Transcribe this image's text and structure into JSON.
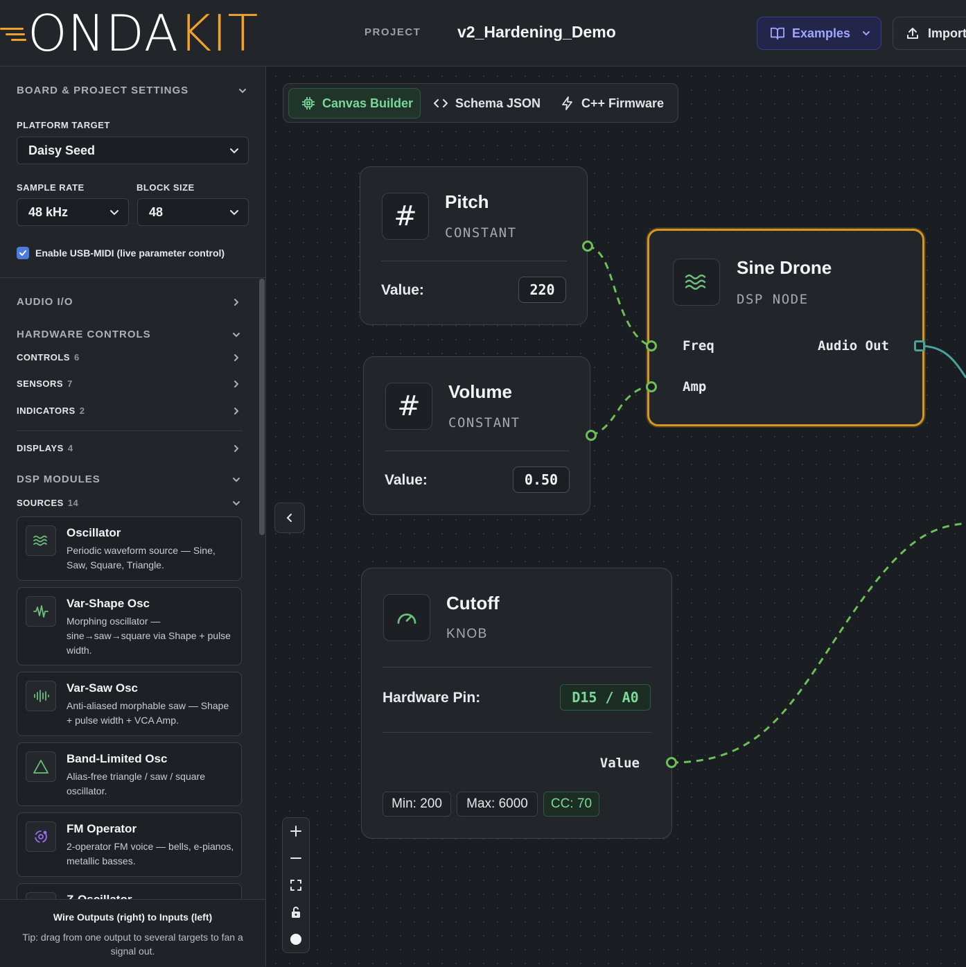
{
  "header": {
    "logo_left": "ONDA",
    "logo_right": "KIT",
    "project_label": "PROJECT",
    "project_name": "v2_Hardening_Demo",
    "examples_label": "Examples",
    "import_label": "Import"
  },
  "sidebar": {
    "board_title": "BOARD & PROJECT SETTINGS",
    "platform_label": "PLATFORM TARGET",
    "platform_value": "Daisy Seed",
    "sample_rate_label": "SAMPLE RATE",
    "sample_rate_value": "48 kHz",
    "block_size_label": "BLOCK SIZE",
    "block_size_value": "48",
    "usb_midi_label": "Enable USB-MIDI (live parameter control)",
    "usb_midi_checked": true,
    "audio_io": "AUDIO I/O",
    "hardware_controls": "HARDWARE CONTROLS",
    "hw_items": [
      {
        "label": "CONTROLS",
        "count": "6"
      },
      {
        "label": "SENSORS",
        "count": "7"
      },
      {
        "label": "INDICATORS",
        "count": "2"
      },
      {
        "label": "DISPLAYS",
        "count": "4"
      }
    ],
    "dsp_modules": "DSP MODULES",
    "sources_label": "SOURCES",
    "sources_count": "14",
    "modules": [
      {
        "name": "Oscillator",
        "desc": "Periodic waveform source — Sine, Saw, Square, Triangle.",
        "icon": "waves-icon"
      },
      {
        "name": "Var-Shape Osc",
        "desc": "Morphing oscillator — sine→saw→square via Shape + pulse width.",
        "icon": "waveform-icon"
      },
      {
        "name": "Var-Saw Osc",
        "desc": "Anti-aliased morphable saw — Shape + pulse width + VCA Amp.",
        "icon": "audio-lines-icon"
      },
      {
        "name": "Band-Limited Osc",
        "desc": "Alias-free triangle / saw / square oscillator.",
        "icon": "triangle-icon"
      },
      {
        "name": "FM Operator",
        "desc": "2-operator FM voice — bells, e-pianos, metallic basses.",
        "icon": "orbit-icon"
      },
      {
        "name": "Z-Oscillator",
        "desc": "",
        "icon": "z-icon"
      }
    ],
    "tip_title": "Wire Outputs (right) to Inputs (left)",
    "tip_text": "Tip: drag from one output to several targets to fan a signal out."
  },
  "tabs": [
    {
      "label": "Canvas Builder",
      "icon": "cpu-icon",
      "active": true
    },
    {
      "label": "Schema JSON",
      "icon": "code-icon",
      "active": false
    },
    {
      "label": "C++ Firmware",
      "icon": "zap-icon",
      "active": false
    }
  ],
  "nodes": {
    "pitch": {
      "title": "Pitch",
      "type": "CONSTANT",
      "value_label": "Value:",
      "value": "220"
    },
    "volume": {
      "title": "Volume",
      "type": "CONSTANT",
      "value_label": "Value:",
      "value": "0.50"
    },
    "sine": {
      "title": "Sine Drone",
      "type": "DSP NODE",
      "in1": "Freq",
      "in2": "Amp",
      "out": "Audio Out"
    },
    "cutoff": {
      "title": "Cutoff",
      "type": "KNOB",
      "pin_label": "Hardware Pin:",
      "pin": "D15 / A0",
      "out": "Value",
      "min": "Min: 200",
      "max": "Max: 6000",
      "cc": "CC: 70"
    }
  },
  "colors": {
    "accent_orange": "#f0a22c",
    "accent_green": "#7bd89a",
    "wire_green": "#6cbf59",
    "selected_border": "#d4961f"
  }
}
